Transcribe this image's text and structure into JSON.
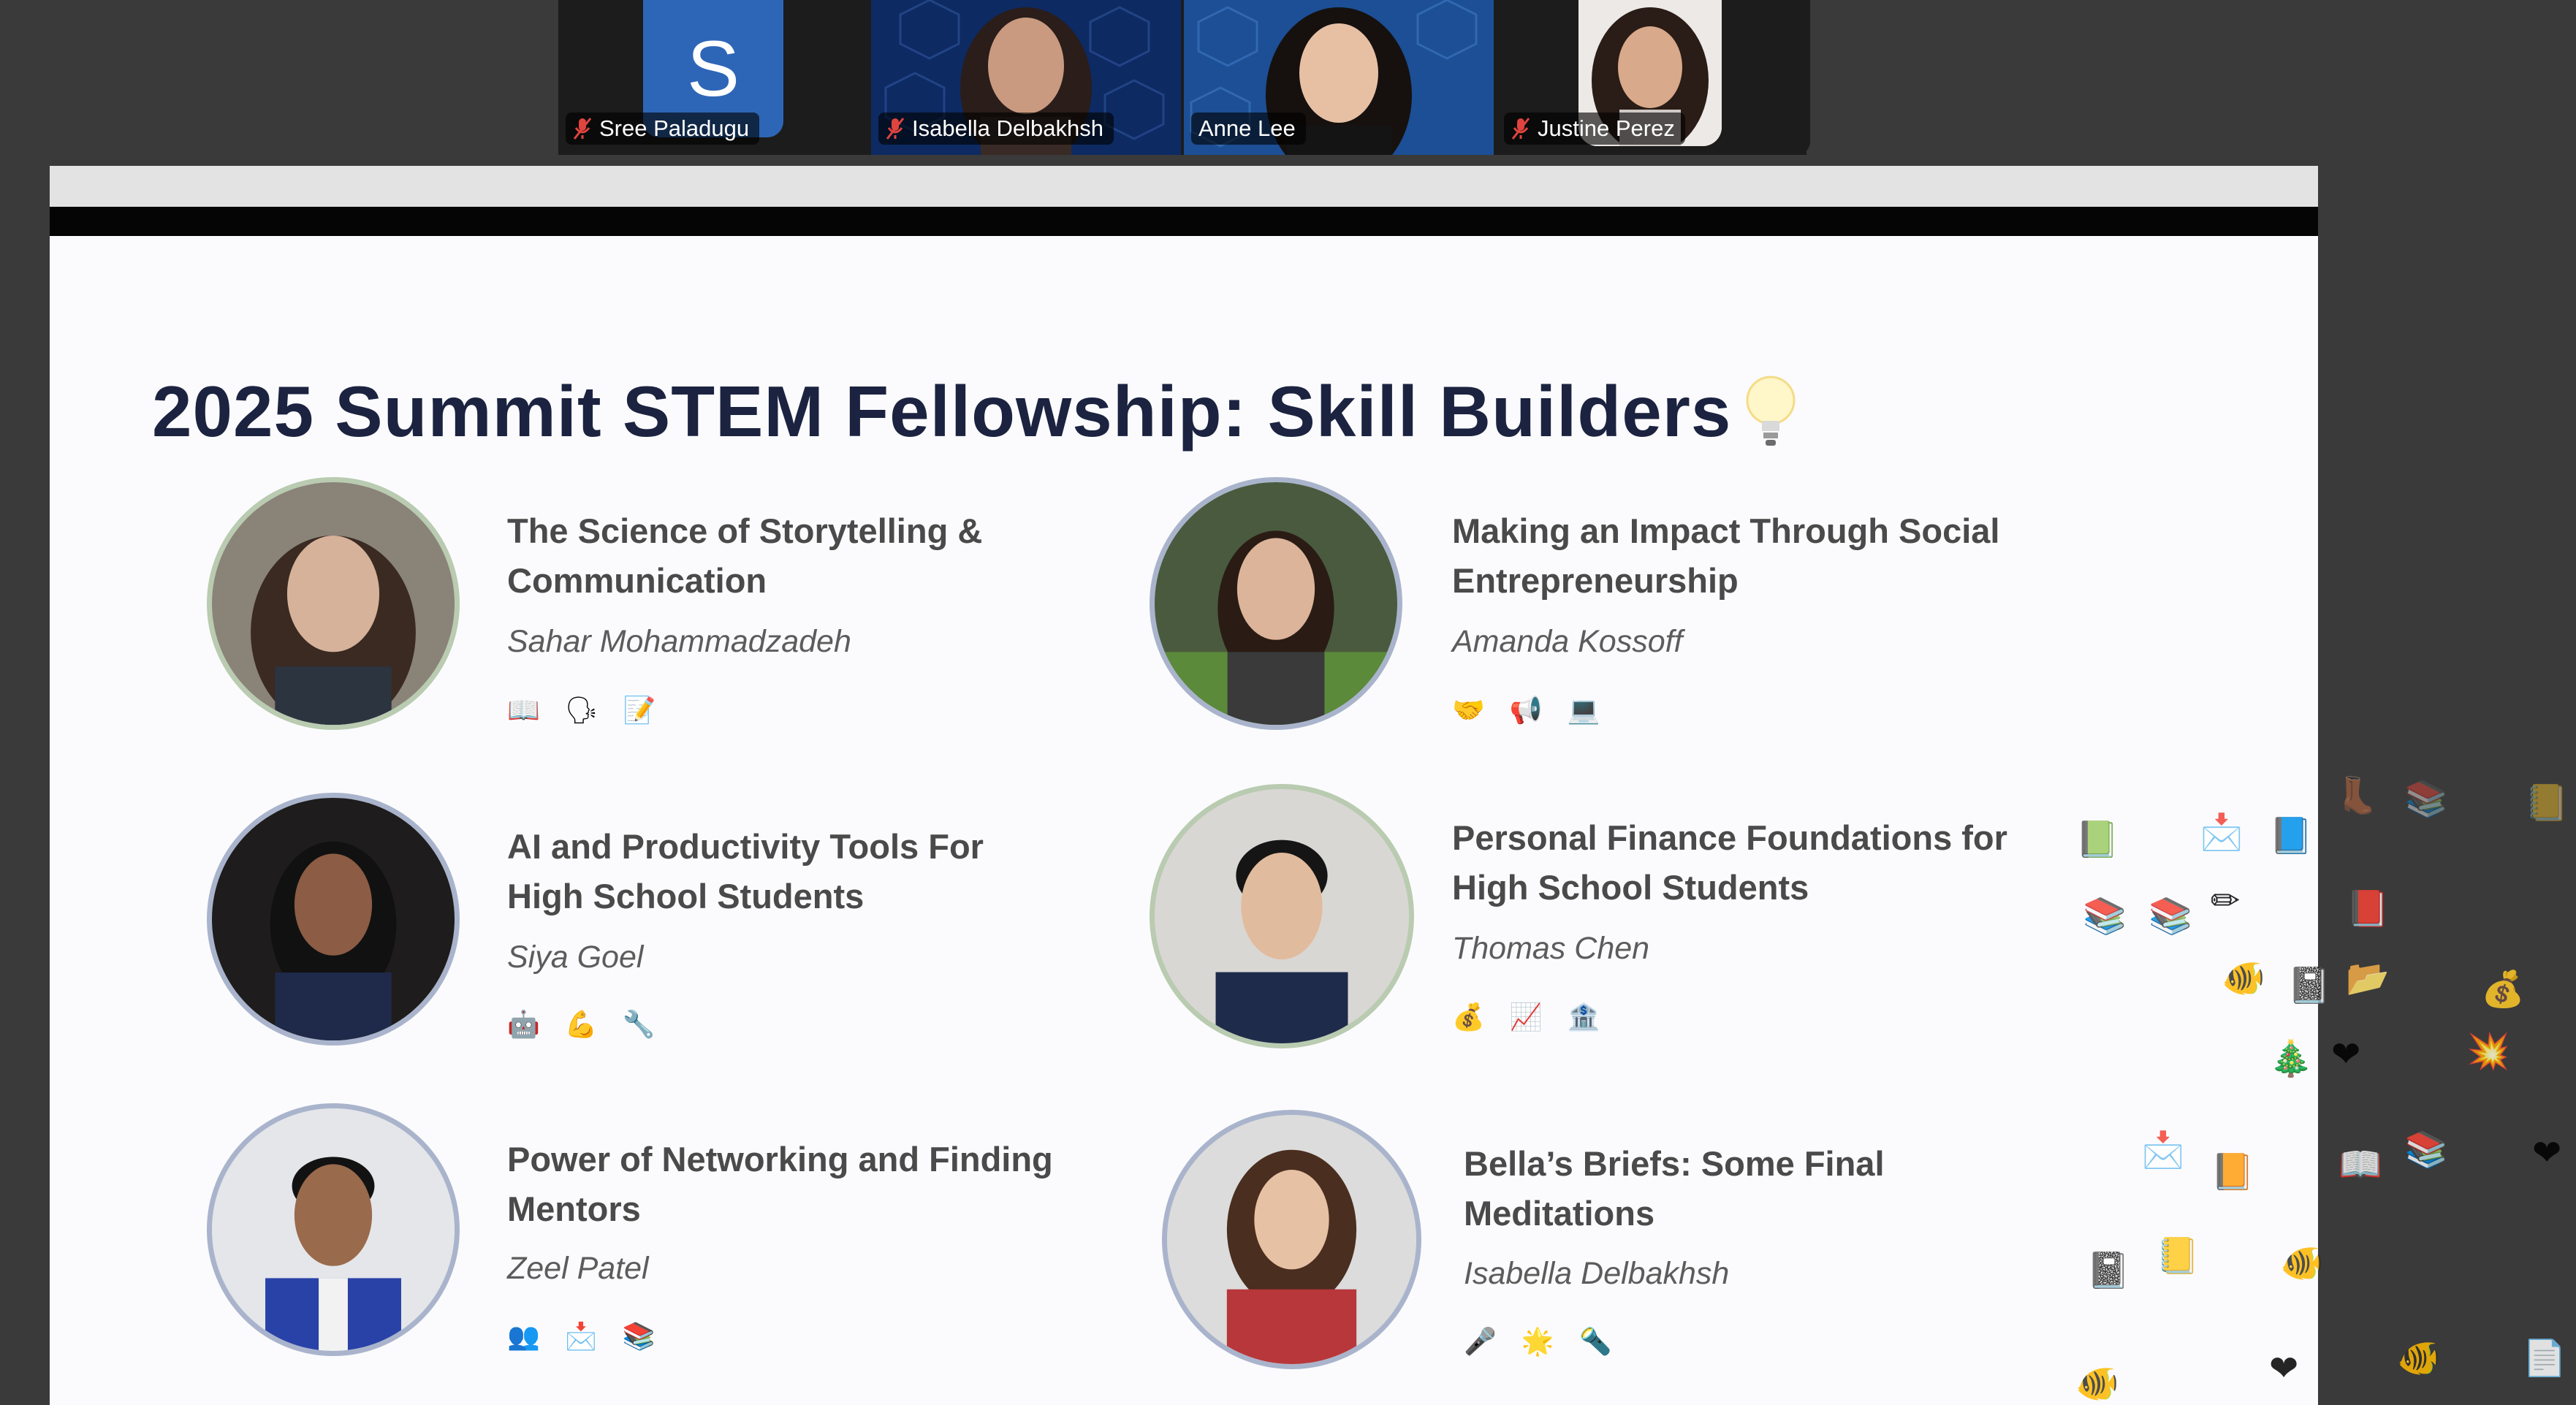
{
  "participants": [
    {
      "name": "Sree Paladugu",
      "initial": "S",
      "muted": true,
      "speaking": false
    },
    {
      "name": "Isabella Delbakhsh",
      "muted": true,
      "speaking": false
    },
    {
      "name": "Anne Lee",
      "muted": false,
      "speaking": true
    },
    {
      "name": "Justine Perez",
      "muted": true,
      "speaking": false
    }
  ],
  "slide": {
    "title": "2025 Summit STEM Fellowship: Skill Builders",
    "title_icon": "lightbulb-icon",
    "sessions": [
      {
        "title": "The Science of Storytelling & Communication",
        "speaker": "Sahar Mohammadzadeh",
        "emojis": "📖🗣📝"
      },
      {
        "title": "Making an Impact Through Social Entrepreneurship",
        "speaker": "Amanda Kossoff",
        "emojis": "🤝📢💻"
      },
      {
        "title": "AI and Productivity Tools For High School Students",
        "speaker": "Siya Goel",
        "emojis": "🤖💪🔧"
      },
      {
        "title": "Personal Finance Foundations for High School Students",
        "speaker": "Thomas Chen",
        "emojis": "💰📈🏦"
      },
      {
        "title": "Power of Networking and Finding Mentors",
        "speaker": "Zeel Patel",
        "emojis": "👥📩📚"
      },
      {
        "title": "Bella’s Briefs: Some Final Meditations",
        "speaker": "Isabella Delbakhsh",
        "emojis": "🎤🌟🔦"
      }
    ]
  },
  "reactions": [
    "📗",
    "📩",
    "📘",
    "📚",
    "📚",
    "✏",
    "📕",
    "🐠",
    "📓",
    "📂",
    "💰",
    "❤",
    "💥",
    "🎄",
    "📩",
    "📙",
    "📖",
    "📚",
    "❤",
    "📓",
    "📒",
    "🐠",
    "🐠",
    "❤",
    "🐠",
    "📄",
    "📚",
    "👢",
    "📒"
  ],
  "colors": {
    "speaking_border": "#3fc75a",
    "mute_icon": "#e0443e",
    "title": "#1b2340",
    "avatar_border": "#b9cbb0"
  }
}
